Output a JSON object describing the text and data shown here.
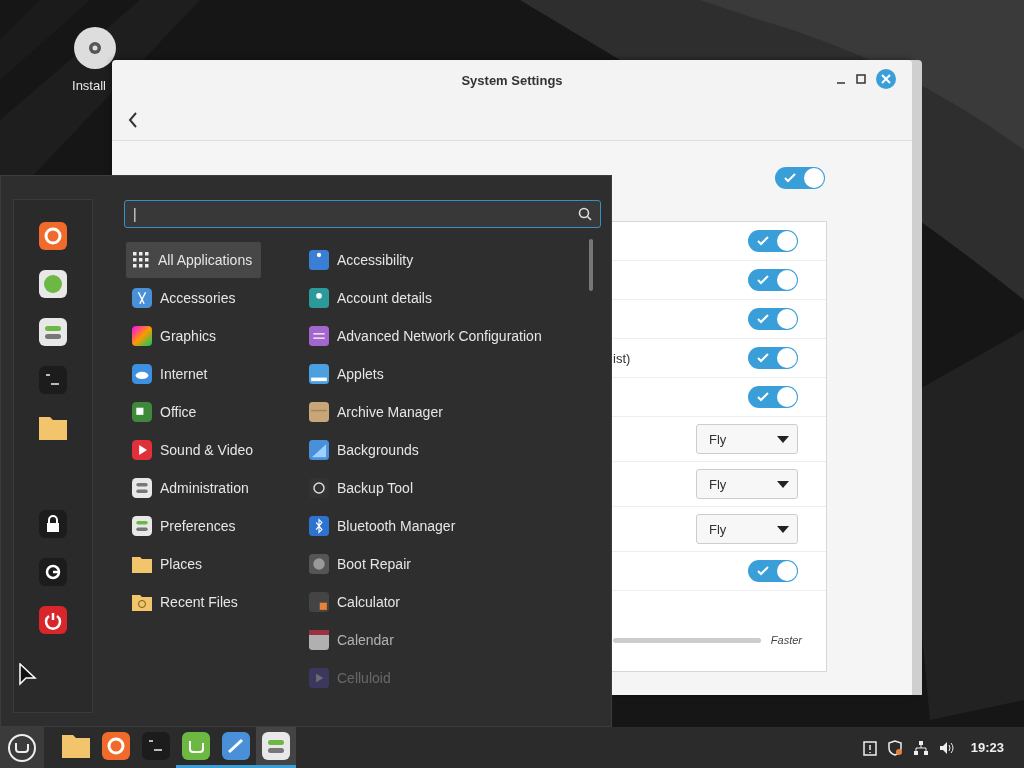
{
  "desktop": {
    "icons": [
      {
        "label": "Install"
      }
    ]
  },
  "settings_window": {
    "title": "System Settings",
    "top_toggle": {
      "on": true
    },
    "rows": [
      {
        "kind": "toggle",
        "on": true
      },
      {
        "kind": "toggle",
        "on": true
      },
      {
        "kind": "toggle",
        "on": true
      },
      {
        "kind": "toggle",
        "label": "ist)",
        "on": true
      },
      {
        "kind": "toggle",
        "on": true
      },
      {
        "kind": "dropdown",
        "value": "Fly"
      },
      {
        "kind": "dropdown",
        "value": "Fly"
      },
      {
        "kind": "dropdown",
        "value": "Fly"
      },
      {
        "kind": "toggle",
        "on": true
      },
      {
        "kind": "slider",
        "end_label": "Faster"
      }
    ]
  },
  "menu": {
    "search": {
      "value": "|"
    },
    "categories": [
      {
        "label": "All Applications",
        "selected": true
      },
      {
        "label": "Accessories",
        "selected": false
      },
      {
        "label": "Graphics",
        "selected": false
      },
      {
        "label": "Internet",
        "selected": false
      },
      {
        "label": "Office",
        "selected": false
      },
      {
        "label": "Sound & Video",
        "selected": false
      },
      {
        "label": "Administration",
        "selected": false
      },
      {
        "label": "Preferences",
        "selected": false
      },
      {
        "label": "Places",
        "selected": false
      },
      {
        "label": "Recent Files",
        "selected": false
      }
    ],
    "applications": [
      "Accessibility",
      "Account details",
      "Advanced Network Configuration",
      "Applets",
      "Archive Manager",
      "Backgrounds",
      "Backup Tool",
      "Bluetooth Manager",
      "Boot Repair",
      "Calculator",
      "Calendar",
      "Celluloid"
    ]
  },
  "taskbar": {
    "apps": [
      {
        "selected": false
      },
      {
        "selected": false
      },
      {
        "selected": false
      },
      {
        "selected": false
      },
      {
        "selected": false
      },
      {
        "selected": true
      }
    ],
    "clock": "19:23"
  }
}
